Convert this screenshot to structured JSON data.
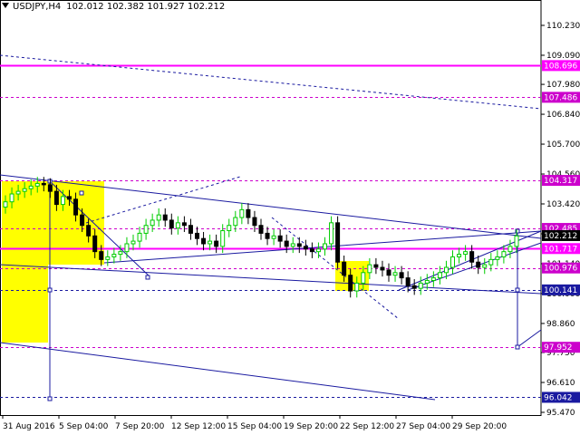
{
  "header": {
    "symbol": "USDJPY,H4",
    "ohlc": "102.012 102.382 101.927 102.212"
  },
  "price_axis": {
    "labels": [
      "110.230",
      "109.090",
      "107.980",
      "106.840",
      "105.700",
      "104.560",
      "103.420",
      "102.280",
      "101.140",
      "100.000",
      "98.860",
      "97.750",
      "96.610",
      "95.470"
    ],
    "min": 95.47,
    "max": 110.23
  },
  "time_axis": {
    "labels": [
      "31 Aug 2016",
      "5 Sep 04:00",
      "7 Sep 20:00",
      "12 Sep 12:00",
      "15 Sep 04:00",
      "19 Sep 20:00",
      "22 Sep 12:00",
      "27 Sep 04:00",
      "29 Sep 20:00"
    ]
  },
  "levels": [
    {
      "value": "108.696",
      "color": "#ff00ff",
      "style": "solid"
    },
    {
      "value": "107.486",
      "color": "#cc00cc",
      "style": "dash"
    },
    {
      "value": "104.317",
      "color": "#cc00cc",
      "style": "dash"
    },
    {
      "value": "102.485",
      "color": "#cc00cc",
      "style": "dash"
    },
    {
      "value": "101.717",
      "color": "#ff00ff",
      "style": "solid"
    },
    {
      "value": "100.976",
      "color": "#cc00cc",
      "style": "dash"
    },
    {
      "value": "100.141",
      "color": "#1a1aa0",
      "style": "dash"
    },
    {
      "value": "97.952",
      "color": "#cc00cc",
      "style": "dash"
    },
    {
      "value": "96.042",
      "color": "#1a1aa0",
      "style": "dash"
    }
  ],
  "current_price": {
    "value": "102.212",
    "color": "#000000"
  },
  "colors": {
    "bull": "#00cc00",
    "bear": "#000000",
    "trendline": "#1a1aa0",
    "zone": "#ffff00",
    "level": "#ff00ff"
  },
  "chart_data": {
    "type": "candlestick",
    "series": [
      {
        "name": "USDJPY,H4",
        "close": [
          103.5,
          103.8,
          103.9,
          104.0,
          104.1,
          104.2,
          104.15,
          103.9,
          103.4,
          103.7,
          103.6,
          103.0,
          102.6,
          102.2,
          101.6,
          101.3,
          101.4,
          101.5,
          101.6,
          101.9,
          102.0,
          102.3,
          102.6,
          102.8,
          103.0,
          102.8,
          102.5,
          102.7,
          102.6,
          102.3,
          102.1,
          101.9,
          102.0,
          101.8,
          102.4,
          102.6,
          102.9,
          103.2,
          102.9,
          102.6,
          102.3,
          102.1,
          102.2,
          102.0,
          101.8,
          101.9,
          101.8,
          101.7,
          101.6,
          101.7,
          101.9,
          102.7,
          101.2,
          100.7,
          100.1,
          100.4,
          100.8,
          101.1,
          101.0,
          100.9,
          100.7,
          100.8,
          100.6,
          100.3,
          100.2,
          100.4,
          100.5,
          100.6,
          100.8,
          101.0,
          101.4,
          101.5,
          101.6,
          101.2,
          101.0,
          101.1,
          101.3,
          101.4,
          101.6,
          101.8,
          102.2
        ]
      }
    ]
  }
}
